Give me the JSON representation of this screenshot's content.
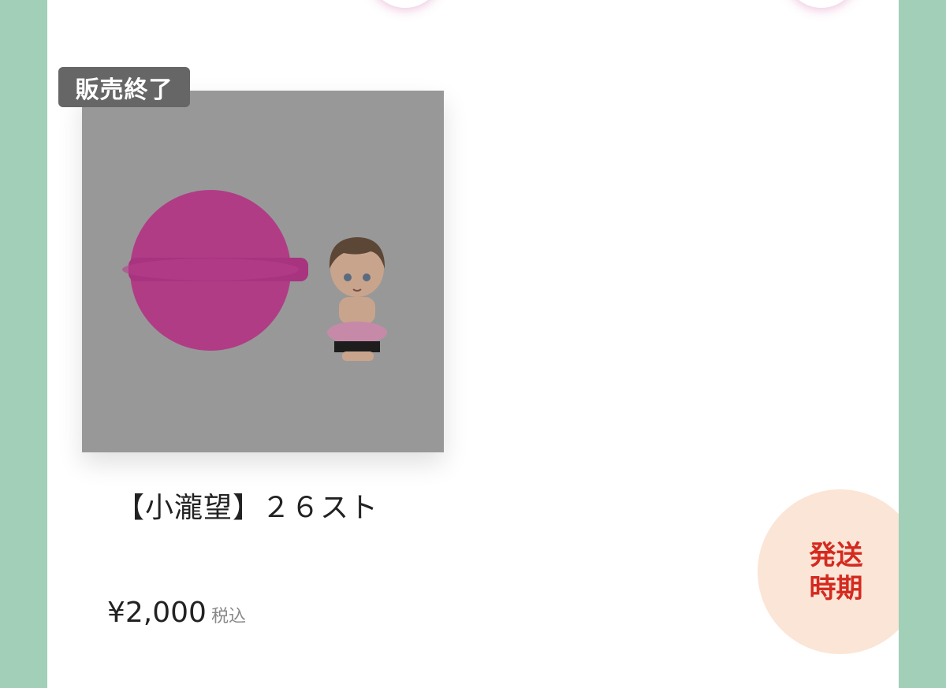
{
  "product": {
    "status_badge": "販売終了",
    "name": "【小瀧望】２６スト",
    "price": "¥2,000",
    "tax_label": "税込",
    "image_alt": "bath bomb and figure"
  },
  "shipping_button": {
    "label": "発送時期"
  },
  "colors": {
    "background": "#a2cfb7",
    "panel": "#ffffff",
    "badge": "#666666",
    "bath_bomb": "#b03c86",
    "shipping_circle": "#fbe5d6",
    "shipping_text": "#d42a20"
  }
}
